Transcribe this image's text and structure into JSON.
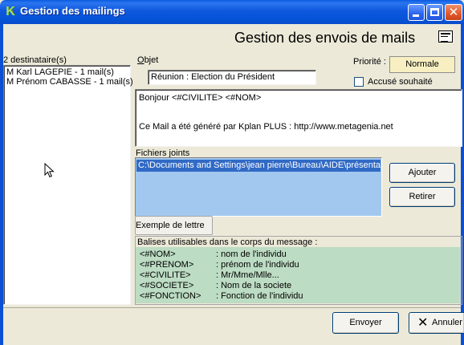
{
  "window": {
    "title": "Gestion des mailings",
    "icon": "kplan-k-icon",
    "controls": {
      "minimize": "minimize-icon",
      "maximize": "maximize-icon",
      "close": "✕"
    }
  },
  "header": {
    "title": "Gestion des envois de mails",
    "icon": "list-icon"
  },
  "recipients": {
    "count_label": "2 destinataire(s)",
    "items": [
      "M Karl LAGEPIE - 1 mail(s)",
      "M Prénom CABASSE - 1 mail(s)"
    ]
  },
  "objet": {
    "label_first": "O",
    "label_rest": "bjet",
    "value": "Réunion : Election du Président"
  },
  "priority": {
    "label": "Priorité :",
    "value": "Normale",
    "color": "#f7efc2"
  },
  "accuse": {
    "label": "Accusé souhaité",
    "checked": false
  },
  "body": {
    "line1": "Bonjour <#CIVILITE> <#NOM>",
    "line2": "Ce Mail a été généré par Kplan PLUS : http://www.metagenia.net"
  },
  "attachments": {
    "label": "Fichiers joints",
    "files": [
      "C:\\Documents and Settings\\jean pierre\\Bureau\\AIDE\\présentation"
    ],
    "add_button": "Ajouter",
    "remove_button": "Retirer"
  },
  "example_button": "Exemple de lettre",
  "balises": {
    "label": "Balises utilisables dans le corps du message :",
    "items": [
      {
        "tag": "<#NOM>",
        "desc": ": nom de l'individu"
      },
      {
        "tag": "<#PRENOM>",
        "desc": ": prénom de l'individu"
      },
      {
        "tag": "<#CIVILITE>",
        "desc": ": Mr/Mme/Mlle..."
      },
      {
        "tag": "<#SOCIETE>",
        "desc": ": Nom de la societe"
      },
      {
        "tag": "<#FONCTION>",
        "desc": ": Fonction de l'individu"
      }
    ],
    "color": "#bcdcc3"
  },
  "footer": {
    "send_button": "Envoyer",
    "cancel_button": "Annuler",
    "cancel_icon": "✕"
  }
}
